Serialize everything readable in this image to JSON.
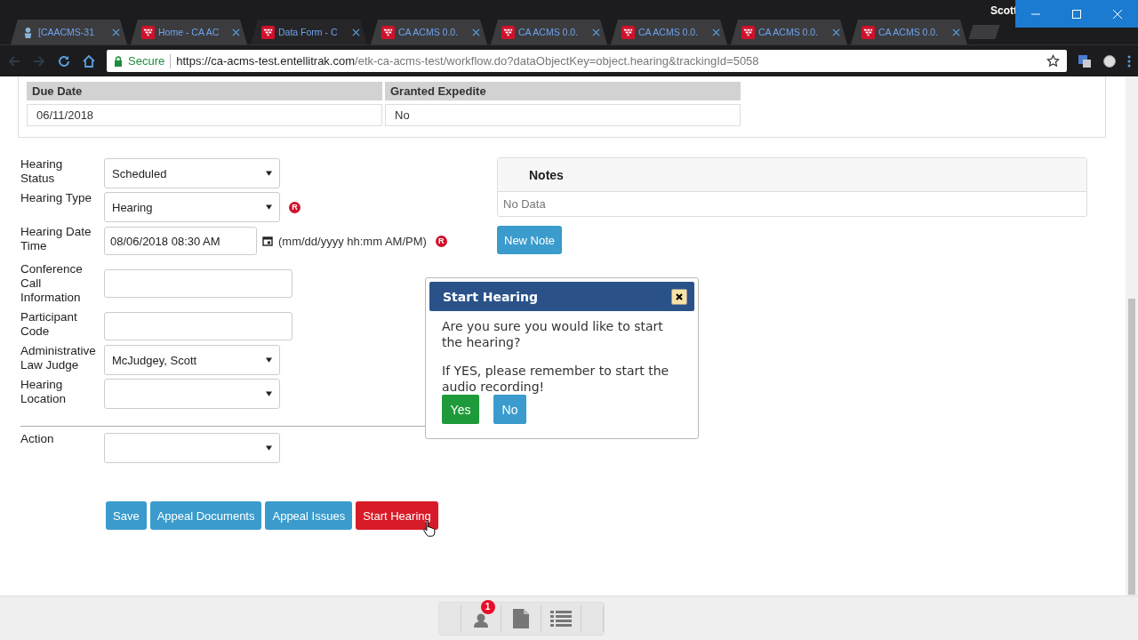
{
  "window": {
    "user": "Scott"
  },
  "tabs": [
    {
      "label": "[CAACMS-31",
      "kind": "tracker",
      "selected": false
    },
    {
      "label": "Home - CA AC",
      "kind": "app",
      "selected": false
    },
    {
      "label": "Data Form - C",
      "kind": "app",
      "selected": true
    },
    {
      "label": "CA ACMS 0.0.",
      "kind": "app",
      "selected": false
    },
    {
      "label": "CA ACMS 0.0.",
      "kind": "app",
      "selected": false
    },
    {
      "label": "CA ACMS 0.0.",
      "kind": "app",
      "selected": false
    },
    {
      "label": "CA ACMS 0.0.",
      "kind": "app",
      "selected": false
    },
    {
      "label": "CA ACMS 0.0.",
      "kind": "app",
      "selected": false
    }
  ],
  "address_bar": {
    "secure_label": "Secure",
    "url_host": "https://ca-acms-test.entellitrak.com",
    "url_path": "/etk-ca-acms-test/workflow.do?dataObjectKey=object.hearing&trackingId=5058"
  },
  "summary_table": {
    "columns": [
      "Due Date",
      "Granted Expedite"
    ],
    "row": [
      "06/11/2018",
      "No"
    ]
  },
  "form": {
    "fields": [
      {
        "label": "Hearing Status",
        "kind": "select",
        "value": "Scheduled"
      },
      {
        "label": "Hearing Type",
        "kind": "select",
        "value": "Hearing",
        "required_mark": "R"
      },
      {
        "label": "Hearing Date Time",
        "kind": "datetime",
        "value": "08/06/2018 08:30 AM",
        "hint": "(mm/dd/yyyy hh:mm AM/PM)",
        "required_mark": "R"
      },
      {
        "label": "Conference Call Information",
        "kind": "text"
      },
      {
        "label": "Participant Code",
        "kind": "text"
      },
      {
        "label": "Administrative Law Judge",
        "kind": "select",
        "value": "McJudgey, Scott"
      },
      {
        "label": "Hearing Location",
        "kind": "select"
      }
    ],
    "action": {
      "label": "Action",
      "kind": "select"
    },
    "buttons": [
      {
        "label": "Save",
        "kind": "primary"
      },
      {
        "label": "Appeal Documents",
        "kind": "primary"
      },
      {
        "label": "Appeal Issues",
        "kind": "primary"
      },
      {
        "label": "Start Hearing",
        "kind": "danger"
      }
    ]
  },
  "notes": {
    "title": "Notes",
    "empty": "No Data",
    "button": "New Note"
  },
  "dialog": {
    "title": "Start Hearing",
    "paragraphs": [
      "Are you sure you would like to start the hearing?",
      "If YES, please remember to start the audio recording!"
    ],
    "buttons": [
      {
        "label": "Yes",
        "kind": "confirm"
      },
      {
        "label": "No",
        "kind": "cancel"
      }
    ]
  },
  "bottom_toolbar": {
    "badge": "1"
  }
}
